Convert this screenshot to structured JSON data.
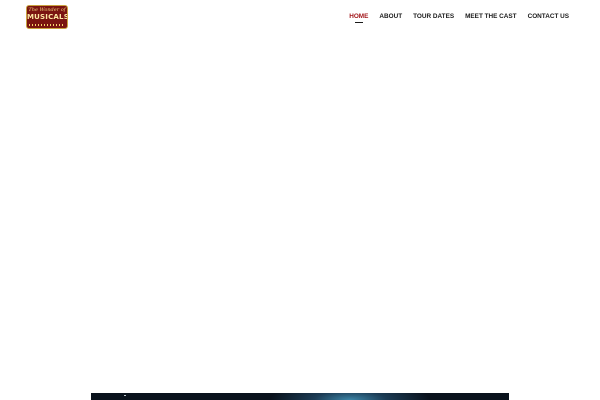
{
  "logo": {
    "line1": "The Wonder of",
    "line2": "MUSICALS"
  },
  "nav": {
    "items": [
      {
        "label": "HOME",
        "active": true
      },
      {
        "label": "ABOUT",
        "active": false
      },
      {
        "label": "TOUR DATES",
        "active": false
      },
      {
        "label": "MEET THE CAST",
        "active": false
      },
      {
        "label": "CONTACT US",
        "active": false
      }
    ]
  },
  "colors": {
    "accent": "#a3171b",
    "text": "#1a1a1a",
    "logo_bg": "#7a1410",
    "logo_gold": "#c9a23e"
  }
}
